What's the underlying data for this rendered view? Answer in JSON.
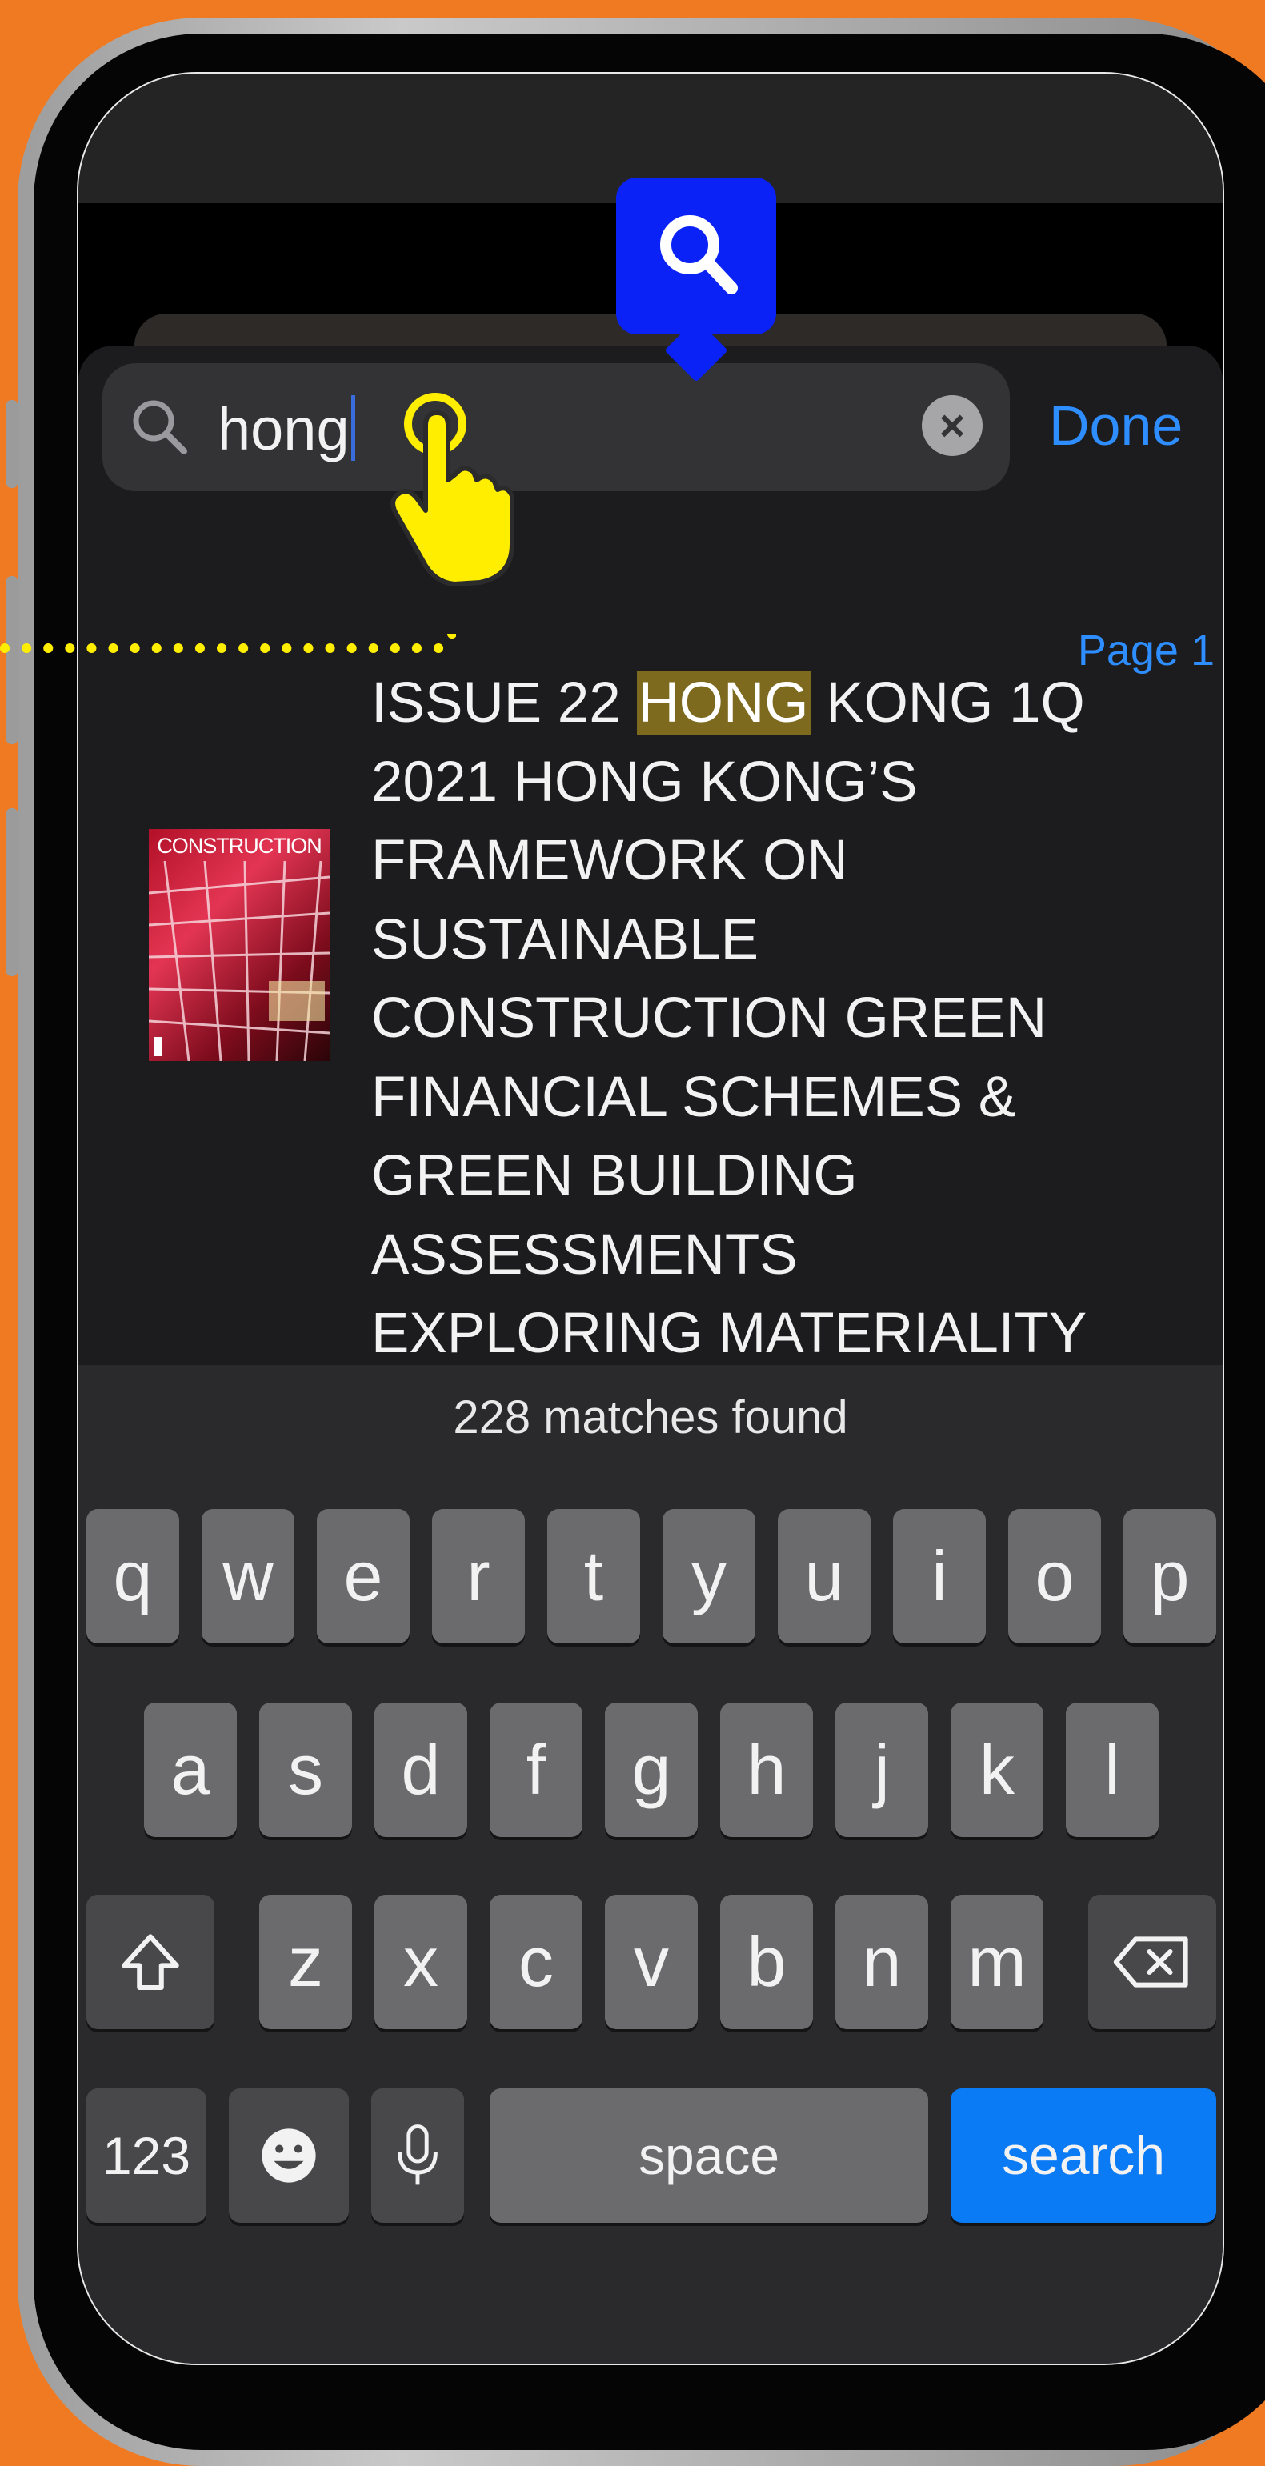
{
  "search": {
    "query": "hong",
    "done_label": "Done"
  },
  "result": {
    "page_label": "Page 1",
    "thumbnail_title": "CONSTRUCTION",
    "text_before": "ISSUE 22 ",
    "text_highlight": "HONG",
    "text_after": " KONG 1Q\n2021 HONG KONG’S\nFRAMEWORK ON\nSUSTAINABLE\nCONSTRUCTION GREEN\nFINANCIAL SCHEMES &\nGREEN BUILDING\nASSESSMENTS\nEXPLORING MATERIALITY"
  },
  "keyboard": {
    "matches_text": "228 matches found",
    "row1": [
      "q",
      "w",
      "e",
      "r",
      "t",
      "y",
      "u",
      "i",
      "o",
      "p"
    ],
    "row2": [
      "a",
      "s",
      "d",
      "f",
      "g",
      "h",
      "j",
      "k",
      "l"
    ],
    "row3": [
      "z",
      "x",
      "c",
      "v",
      "b",
      "n",
      "m"
    ],
    "numbers_label": "123",
    "space_label": "space",
    "search_label": "search"
  },
  "colors": {
    "background": "#f07a22",
    "accent_blue": "#2e8dff",
    "highlight": "#7d6a1e",
    "annotation_blue": "#0a22f5",
    "annotation_hand": "#ffee00"
  },
  "icons": {
    "search_field": "magnifier-icon",
    "clear": "clear-x-icon",
    "shift": "shift-icon",
    "delete": "backspace-icon",
    "emoji": "emoji-icon",
    "dictation": "microphone-icon",
    "annotation": "search-badge-icon",
    "pointer": "tap-hand-icon"
  }
}
